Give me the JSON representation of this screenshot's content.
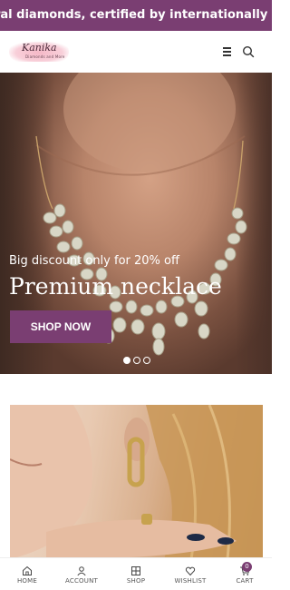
{
  "announcement": "ral diamonds, certified by internationally recognised l",
  "header": {
    "logo_name": "Kanika",
    "logo_tagline": "Diamonds and More"
  },
  "hero": {
    "subtitle": "Big discount only for 20% off",
    "title": "Premium necklace",
    "cta_label": "SHOP NOW",
    "slides": {
      "total": 3,
      "active": 1
    }
  },
  "colors": {
    "brand": "#7a3e72",
    "announcement_text": "#ffffff"
  },
  "bottom_nav": {
    "items": [
      {
        "label": "HOME",
        "icon": "home-icon"
      },
      {
        "label": "ACCOUNT",
        "icon": "user-icon"
      },
      {
        "label": "SHOP",
        "icon": "grid-icon"
      },
      {
        "label": "WISHLIST",
        "icon": "heart-icon"
      },
      {
        "label": "CART",
        "icon": "cart-icon"
      }
    ],
    "cart_count": "0"
  }
}
